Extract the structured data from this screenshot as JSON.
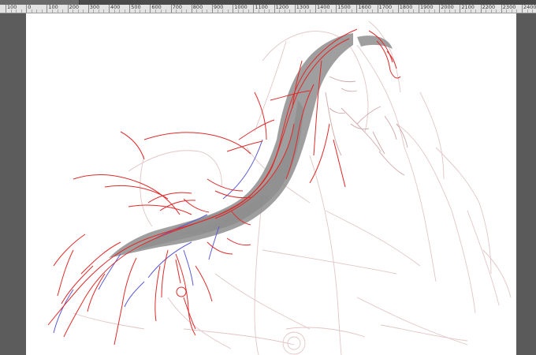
{
  "window": {
    "tabs": [
      "",
      ""
    ]
  },
  "ruler": {
    "labels": [
      "100",
      "0",
      "100",
      "200",
      "300",
      "400",
      "500",
      "600",
      "700",
      "800",
      "900",
      "1000",
      "1100",
      "1200",
      "1300",
      "1400",
      "1500",
      "1600",
      "1700",
      "1800",
      "1900",
      "2000",
      "2100",
      "2200",
      "2300",
      "2400"
    ]
  },
  "artwork": {
    "subject": "line sketch"
  }
}
